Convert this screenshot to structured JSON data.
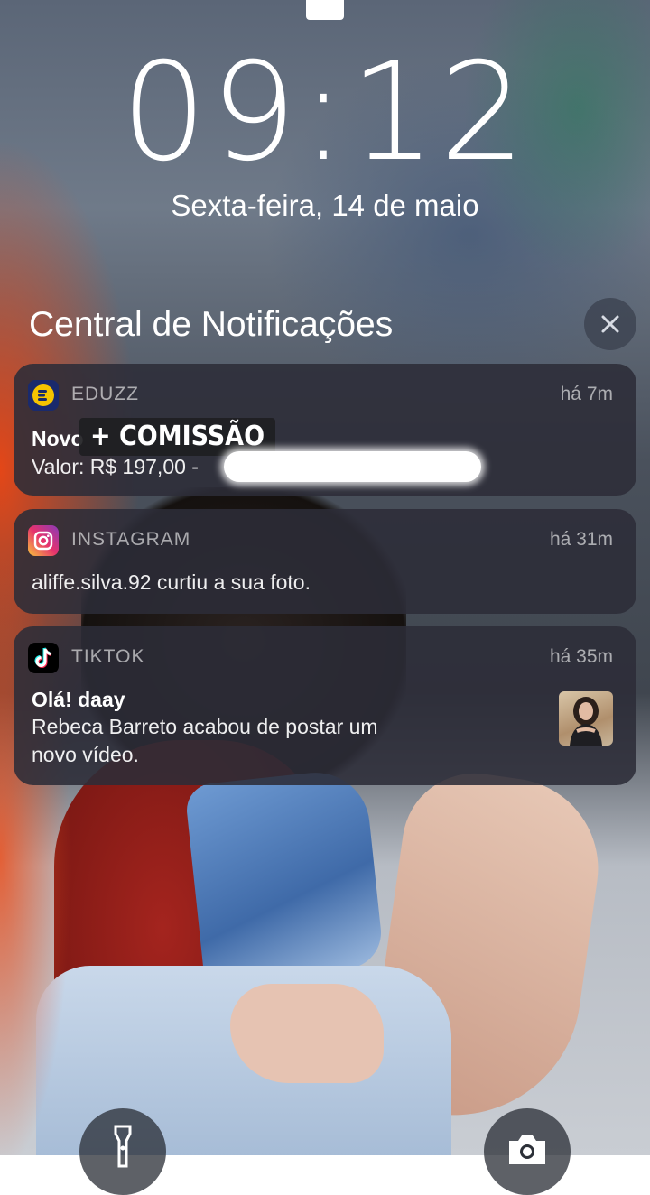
{
  "lockscreen": {
    "time": "09:12",
    "date": "Sexta-feira, 14 de maio"
  },
  "notification_center": {
    "title": "Central de Notificações"
  },
  "notifications": [
    {
      "app": "EDUZZ",
      "time": "há 7m",
      "title": "Novo",
      "body": "Valor: R$ 197,00 -",
      "overlay_label": "+ COMISSÃO",
      "icon": "eduzz-icon"
    },
    {
      "app": "INSTAGRAM",
      "time": "há 31m",
      "body": "aliffe.silva.92 curtiu a sua foto.",
      "icon": "instagram-icon"
    },
    {
      "app": "TIKTOK",
      "time": "há 35m",
      "title": "Olá! daay",
      "body_line1": "Rebeca Barreto  acabou de postar um",
      "body_line2": "novo vídeo.",
      "icon": "tiktok-icon"
    }
  ],
  "icons": {
    "close": "close-icon",
    "flashlight": "flashlight-icon",
    "camera": "camera-icon"
  },
  "colors": {
    "card_bg": "#2c2c38",
    "accent_orange": "#ec4614",
    "eduzz_yellow": "#f5c400",
    "eduzz_blue": "#1a2a6c"
  }
}
